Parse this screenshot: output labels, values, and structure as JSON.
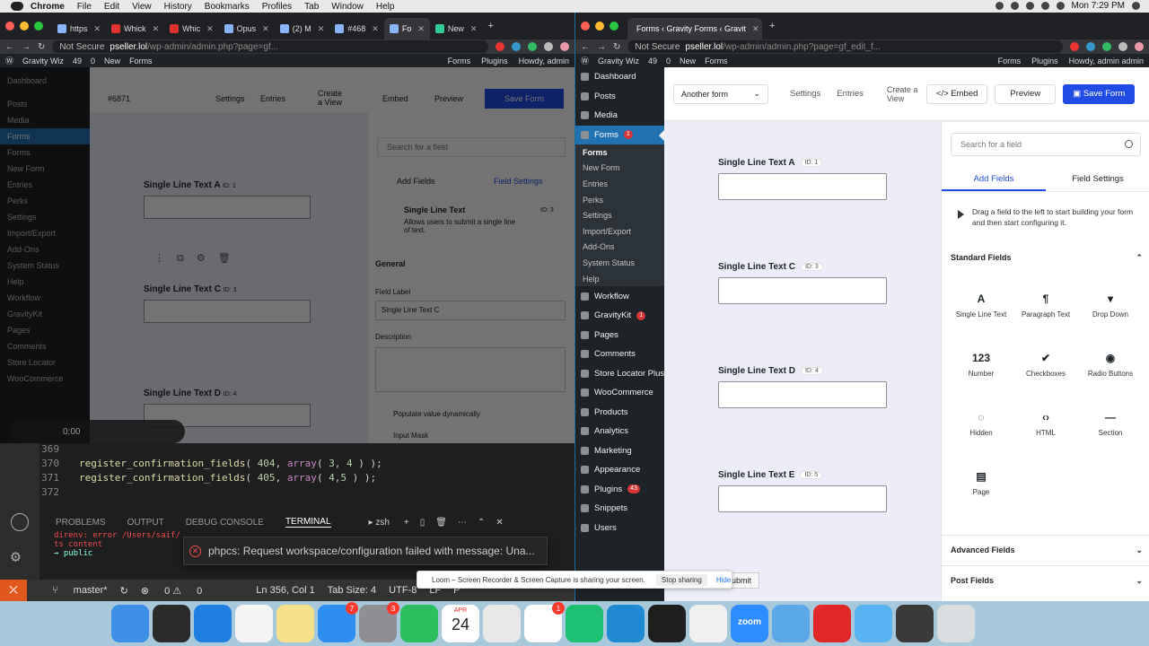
{
  "menubar": {
    "items": [
      "Chrome",
      "File",
      "Edit",
      "View",
      "History",
      "Bookmarks",
      "Profiles",
      "Tab",
      "Window",
      "Help"
    ],
    "clock": "Mon 7:29 PM"
  },
  "left_browser": {
    "tabs": [
      "https",
      "Whick",
      "Whic",
      "Opus",
      "(2) M",
      "#468",
      "Fo",
      "New"
    ],
    "address": {
      "security": "Not Secure",
      "domain": "pseller.lol",
      "path": "/wp-admin/admin.php?page=gf..."
    },
    "wpbar": {
      "site": "Gravity Wiz",
      "updates": "49",
      "comments": "0",
      "new": "New",
      "forms": "Forms",
      "right": [
        "Forms",
        "Plugins",
        "Howdy, admin"
      ]
    },
    "header": {
      "form_select": "#6871",
      "links": [
        "Settings",
        "Entries",
        "Create a View"
      ],
      "embed": "Embed",
      "preview": "Preview",
      "save": "Save Form"
    },
    "sidebar": [
      "Dashboard",
      "Posts",
      "Media",
      "Forms",
      "Forms",
      "New Form",
      "Entries",
      "Perks",
      "Settings",
      "Import/Export",
      "Add-Ons",
      "System Status",
      "Help",
      "Workflow",
      "GravityKit",
      "Pages",
      "Comments",
      "Store Locator",
      "WooCommerce"
    ],
    "fields": [
      {
        "label": "Single Line Text A",
        "id": "ID: 1"
      },
      {
        "label": "Single Line Text C",
        "id": "ID: 3"
      },
      {
        "label": "Single Line Text D",
        "id": "ID: 4"
      }
    ],
    "panel": {
      "search_placeholder": "Search for a field",
      "tab_add": "Add Fields",
      "tab_settings": "Field Settings",
      "field_type": "Single Line Text",
      "field_type_id": "ID: 3",
      "field_type_desc": "Allows users to submit a single line of text.",
      "section": "General",
      "field_label_caption": "Field Label",
      "field_label_value": "Single Line Text C",
      "description_caption": "Description",
      "opt1": "Populate value dynamically",
      "opt2": "Input Mask"
    },
    "recorder_time": "0:00"
  },
  "vscode": {
    "lines": [
      {
        "n": "369",
        "fn": "",
        "args": ""
      },
      {
        "n": "370",
        "fn": "register_confirmation_fields",
        "num": "404",
        "arr": "array",
        "vals": "3, 4"
      },
      {
        "n": "371",
        "fn": "register_confirmation_fields",
        "num": "405",
        "arr": "array",
        "vals": "4,5"
      },
      {
        "n": "372",
        "fn": "",
        "args": ""
      }
    ],
    "panel_tabs": [
      "PROBLEMS",
      "OUTPUT",
      "DEBUG CONSOLE",
      "TERMINAL"
    ],
    "shell": "zsh",
    "terminal": [
      "direnv: error /Users/saif/",
      "ts content",
      "→ public"
    ],
    "notification": "phpcs: Request workspace/configuration failed with message: Una...",
    "status": {
      "branch": "master*",
      "errors": "0",
      "warnings": "0",
      "position": "Ln 356, Col 1",
      "tab_size": "Tab Size: 4",
      "encoding": "UTF-8",
      "eol": "LF",
      "lang": "P"
    }
  },
  "right_browser": {
    "tab_title": "Forms ‹ Gravity Forms ‹ Gravit",
    "address": {
      "security": "Not Secure",
      "domain": "pseller.lol",
      "path": "/wp-admin/admin.php?page=gf_edit_f..."
    },
    "wpbar": {
      "site": "Gravity Wiz",
      "updates": "49",
      "comments": "0",
      "new": "New",
      "forms": "Forms",
      "right": [
        "Forms",
        "Plugins",
        "Howdy, admin admin"
      ]
    },
    "sidebar": {
      "items": [
        {
          "label": "Dashboard",
          "badge": ""
        },
        {
          "label": "Posts",
          "badge": ""
        },
        {
          "label": "Media",
          "badge": ""
        },
        {
          "label": "Forms",
          "badge": "1",
          "current": true
        }
      ],
      "submenu": [
        "Forms",
        "New Form",
        "Entries",
        "Perks",
        "Settings",
        "Import/Export",
        "Add-Ons",
        "System Status",
        "Help"
      ],
      "items_after": [
        {
          "label": "Workflow",
          "badge": ""
        },
        {
          "label": "GravityKit",
          "badge": "1"
        },
        {
          "label": "Pages",
          "badge": ""
        },
        {
          "label": "Comments",
          "badge": ""
        },
        {
          "label": "Store Locator Plus®",
          "badge": ""
        },
        {
          "label": "WooCommerce",
          "badge": ""
        },
        {
          "label": "Products",
          "badge": ""
        },
        {
          "label": "Analytics",
          "badge": ""
        },
        {
          "label": "Marketing",
          "badge": ""
        },
        {
          "label": "Appearance",
          "badge": ""
        },
        {
          "label": "Plugins",
          "badge": "43"
        },
        {
          "label": "Snippets",
          "badge": ""
        },
        {
          "label": "Users",
          "badge": ""
        }
      ]
    },
    "header": {
      "form_select": "Another form",
      "settings": "Settings",
      "entries": "Entries",
      "create_view": "Create a View",
      "embed": "Embed",
      "preview": "Preview",
      "save": "Save Form"
    },
    "fields": [
      {
        "label": "Single Line Text A",
        "id": "ID: 1"
      },
      {
        "label": "Single Line Text C",
        "id": "ID: 3"
      },
      {
        "label": "Single Line Text D",
        "id": "ID: 4"
      },
      {
        "label": "Single Line Text E",
        "id": "ID: 5"
      }
    ],
    "submit": "Submit",
    "panel": {
      "search_placeholder": "Search for a field",
      "tab_add": "Add Fields",
      "tab_settings": "Field Settings",
      "hint": "Drag a field to the left to start building your form and then start configuring it.",
      "standard": "Standard Fields",
      "advanced": "Advanced Fields",
      "post": "Post Fields",
      "field_buttons": [
        {
          "glyph": "A",
          "label": "Single Line Text"
        },
        {
          "glyph": "¶",
          "label": "Paragraph Text"
        },
        {
          "glyph": "▾",
          "label": "Drop Down"
        },
        {
          "glyph": "123",
          "label": "Number"
        },
        {
          "glyph": "✔",
          "label": "Checkboxes"
        },
        {
          "glyph": "◉",
          "label": "Radio Buttons"
        },
        {
          "glyph": "◌",
          "label": "Hidden"
        },
        {
          "glyph": "‹›",
          "label": "HTML"
        },
        {
          "glyph": "—",
          "label": "Section"
        },
        {
          "glyph": "▤",
          "label": "Page"
        }
      ]
    }
  },
  "loom": {
    "message": "Loom – Screen Recorder & Screen Capture is sharing your screen.",
    "stop": "Stop sharing",
    "hide": "Hide"
  },
  "dock": {
    "apps": [
      {
        "name": "finder",
        "color": "#3d8fe8",
        "badge": ""
      },
      {
        "name": "terminal-alt",
        "color": "#2b2b2b",
        "badge": ""
      },
      {
        "name": "safari",
        "color": "#1f7fe0",
        "badge": ""
      },
      {
        "name": "word-app",
        "color": "#f4f4f4",
        "badge": ""
      },
      {
        "name": "notes",
        "color": "#f7e08a",
        "badge": ""
      },
      {
        "name": "app-store",
        "color": "#2e8ef0",
        "badge": "7"
      },
      {
        "name": "system-preferences",
        "color": "#8e8e93",
        "badge": "3"
      },
      {
        "name": "evernote",
        "color": "#2dbe60",
        "badge": ""
      },
      {
        "name": "calendar",
        "color": "#ffffff",
        "badge": ""
      },
      {
        "name": "chrome",
        "color": "#e8e8e8",
        "badge": ""
      },
      {
        "name": "slack",
        "color": "#ffffff",
        "badge": "1"
      },
      {
        "name": "gitkraken",
        "color": "#1dbf73",
        "badge": ""
      },
      {
        "name": "vscode",
        "color": "#1f8ad2",
        "badge": ""
      },
      {
        "name": "terminal",
        "color": "#1e1e1e",
        "badge": ""
      },
      {
        "name": "vlc",
        "color": "#f0f0f0",
        "badge": ""
      },
      {
        "name": "zoom",
        "color": "#2d8cff",
        "badge": ""
      },
      {
        "name": "preview",
        "color": "#5aa9e6",
        "badge": ""
      },
      {
        "name": "brave-b",
        "color": "#e12727",
        "badge": ""
      },
      {
        "name": "downloads-folder",
        "color": "#58b4f0",
        "badge": ""
      },
      {
        "name": "window-stack",
        "color": "#3a3a3a",
        "badge": ""
      },
      {
        "name": "trash",
        "color": "#d9dde0",
        "badge": ""
      }
    ],
    "calendar_month": "APR",
    "calendar_day": "24",
    "zoom_text": "zoom"
  }
}
